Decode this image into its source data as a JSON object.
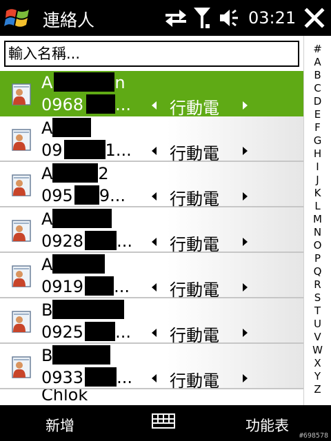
{
  "titlebar": {
    "title": "連絡人",
    "time": "03:21"
  },
  "search": {
    "placeholder": "輸入名稱..."
  },
  "contacts": [
    {
      "name_start": "A",
      "name_end": "n",
      "phone_start": "0968",
      "phone_end": "...",
      "type": "行動電",
      "selected": true
    },
    {
      "name_start": "A",
      "name_end": "",
      "phone_start": "09",
      "phone_end": "1...",
      "type": "行動電",
      "selected": false
    },
    {
      "name_start": "A",
      "name_end": "2",
      "phone_start": "095",
      "phone_end": "9...",
      "type": "行動電",
      "selected": false
    },
    {
      "name_start": "A",
      "name_end": "",
      "phone_start": "0928",
      "phone_end": "...",
      "type": "行動電",
      "selected": false
    },
    {
      "name_start": "A",
      "name_end": "",
      "phone_start": "0919",
      "phone_end": "...",
      "type": "行動電",
      "selected": false
    },
    {
      "name_start": "B",
      "name_end": "",
      "phone_start": "0925",
      "phone_end": "...",
      "type": "行動電",
      "selected": false
    },
    {
      "name_start": "B",
      "name_end": "",
      "phone_start": "0933",
      "phone_end": "...",
      "type": "行動電",
      "selected": false
    }
  ],
  "partial_row": {
    "name": "Chlok"
  },
  "alphabet": [
    "#",
    "A",
    "B",
    "C",
    "D",
    "E",
    "F",
    "G",
    "H",
    "I",
    "J",
    "K",
    "L",
    "M",
    "N",
    "O",
    "P",
    "Q",
    "R",
    "S",
    "T",
    "U",
    "V",
    "W",
    "X",
    "Y",
    "Z"
  ],
  "softkeys": {
    "left": "新增",
    "right": "功能表"
  },
  "watermark": "#698578",
  "colors": {
    "selection": "#5faa15",
    "bar": "#000000"
  }
}
